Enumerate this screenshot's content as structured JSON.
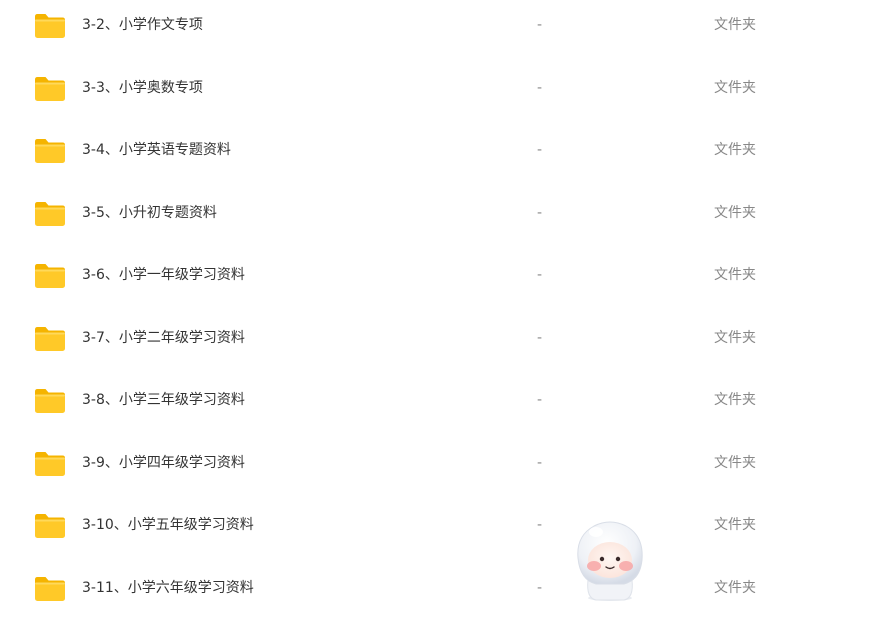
{
  "file_list": {
    "items": [
      {
        "name": "3-2、小学作文专项",
        "size": "-",
        "type": "文件夹",
        "icon": "folder-icon"
      },
      {
        "name": "3-3、小学奥数专项",
        "size": "-",
        "type": "文件夹",
        "icon": "folder-icon"
      },
      {
        "name": "3-4、小学英语专题资料",
        "size": "-",
        "type": "文件夹",
        "icon": "folder-icon"
      },
      {
        "name": "3-5、小升初专题资料",
        "size": "-",
        "type": "文件夹",
        "icon": "folder-icon"
      },
      {
        "name": "3-6、小学一年级学习资料",
        "size": "-",
        "type": "文件夹",
        "icon": "folder-icon"
      },
      {
        "name": "3-7、小学二年级学习资料",
        "size": "-",
        "type": "文件夹",
        "icon": "folder-icon"
      },
      {
        "name": "3-8、小学三年级学习资料",
        "size": "-",
        "type": "文件夹",
        "icon": "folder-icon"
      },
      {
        "name": "3-9、小学四年级学习资料",
        "size": "-",
        "type": "文件夹",
        "icon": "folder-icon"
      },
      {
        "name": "3-10、小学五年级学习资料",
        "size": "-",
        "type": "文件夹",
        "icon": "folder-icon"
      },
      {
        "name": "3-11、小学六年级学习资料",
        "size": "-",
        "type": "文件夹",
        "icon": "folder-icon"
      }
    ]
  },
  "colors": {
    "folder_body": "#FFC928",
    "folder_tab": "#F5B400",
    "name_text": "#333333",
    "meta_text": "#888888"
  },
  "mascot": {
    "icon": "assistant-mascot-icon"
  }
}
